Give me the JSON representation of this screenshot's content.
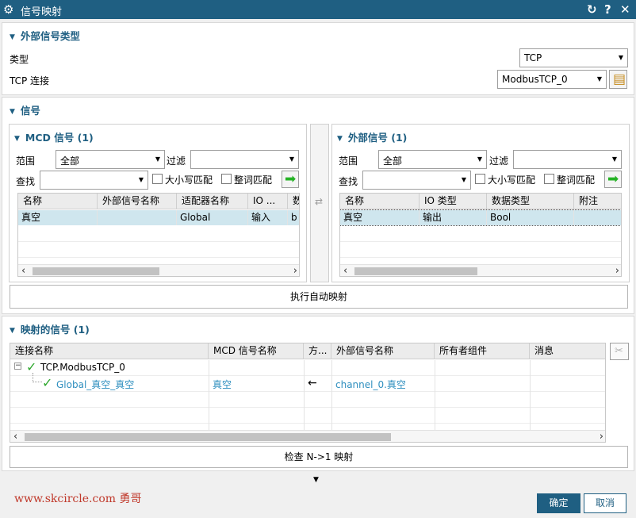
{
  "dialog": {
    "title": "信号映射",
    "gear_icon": "gear-icon",
    "reset_icon": "reset-icon",
    "help_label": "?",
    "close_icon": "close-icon"
  },
  "external_type": {
    "title": "外部信号类型",
    "type_label": "类型",
    "type_value": "TCP",
    "tcp_label": "TCP 连接",
    "tcp_value": "ModbusTCP_0",
    "tcp_button_icon": "connection-settings-icon"
  },
  "signals": {
    "title": "信号",
    "mcd": {
      "title": "MCD 信号 (1)",
      "range_label": "范围",
      "range_value": "全部",
      "filter_label": "过滤",
      "filter_value": "",
      "find_label": "查找",
      "find_value": "",
      "case_label": "大小写匹配",
      "word_label": "整词匹配",
      "columns": [
        "名称",
        "外部信号名称",
        "适配器名称",
        "IO ...",
        "数"
      ],
      "rows": [
        [
          "真空",
          "",
          "Global",
          "输入",
          "b"
        ]
      ]
    },
    "external": {
      "title": "外部信号 (1)",
      "range_label": "范围",
      "range_value": "全部",
      "filter_label": "过滤",
      "filter_value": "",
      "find_label": "查找",
      "find_value": "",
      "case_label": "大小写匹配",
      "word_label": "整词匹配",
      "columns": [
        "名称",
        "IO 类型",
        "数据类型",
        "附注"
      ],
      "rows": [
        [
          "真空",
          "输出",
          "Bool",
          ""
        ]
      ]
    },
    "auto_map_label": "执行自动映射"
  },
  "mapped": {
    "title": "映射的信号 (1)",
    "columns": [
      "连接名称",
      "MCD 信号名称",
      "方...",
      "外部信号名称",
      "所有者组件",
      "消息"
    ],
    "tree": [
      {
        "name": "TCP.ModbusTCP_0",
        "mcd": "",
        "dir": "",
        "ext": "",
        "owner": "",
        "msg": ""
      },
      {
        "name": "Global_真空_真空",
        "mcd": "真空",
        "dir": "←",
        "ext": "channel_0.真空",
        "owner": "",
        "msg": ""
      }
    ],
    "check_label": "检查 N->1 映射"
  },
  "footer": {
    "ok_label": "确定",
    "cancel_label": "取消",
    "watermark": "www.skcircle.com  勇哥"
  },
  "colors": {
    "titlebar": "#1f5f82",
    "heading": "#1f5f82",
    "selection": "#cfe6ee",
    "link": "#2f8fbf",
    "check": "#2ea82e"
  }
}
